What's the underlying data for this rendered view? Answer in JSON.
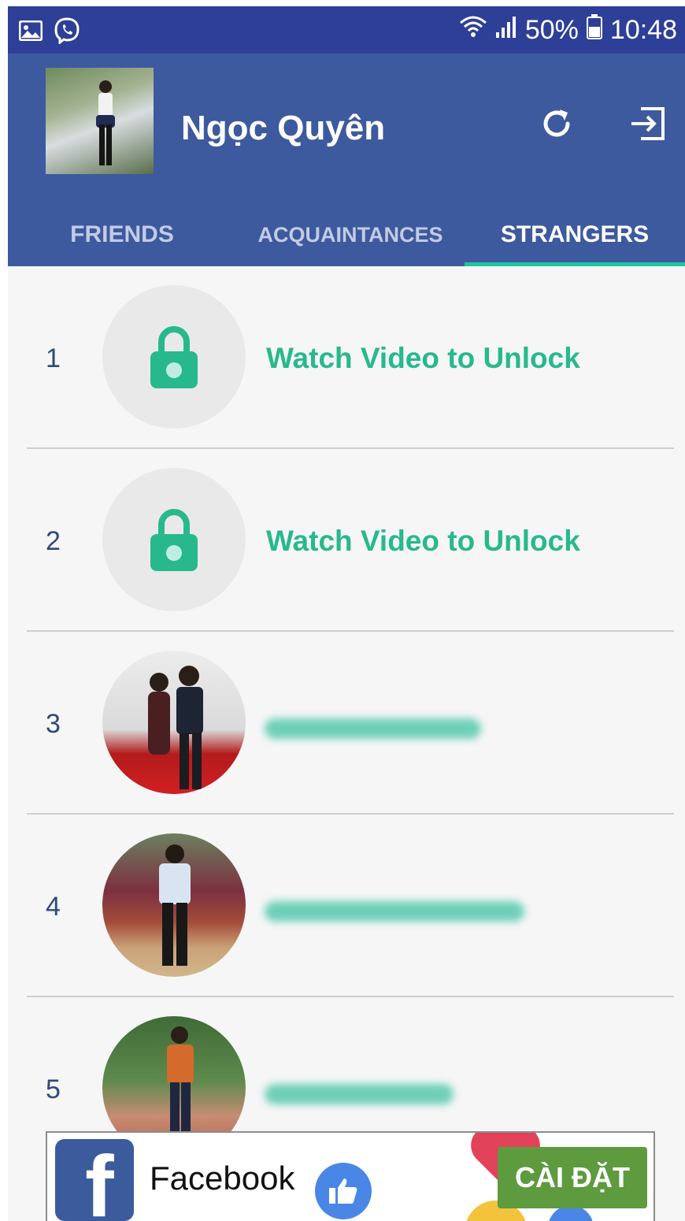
{
  "status_bar": {
    "signal_percent": "50%",
    "time": "10:48",
    "icons": [
      "gallery-icon",
      "viber-icon",
      "wifi-icon",
      "signal-icon",
      "battery-icon"
    ]
  },
  "header": {
    "profile_name": "Ngọc Quyên",
    "actions": [
      "refresh-icon",
      "logout-icon"
    ],
    "colors": {
      "status_bar": "#2d3f96",
      "header": "#3d5a9e",
      "accent": "#1fc4a0"
    }
  },
  "tabs": [
    {
      "label": "FRIENDS",
      "selected": false
    },
    {
      "label": "ACQUAINTANCES",
      "selected": false
    },
    {
      "label": "STRANGERS",
      "selected": true
    }
  ],
  "list": {
    "items": [
      {
        "rank": "1",
        "locked": true,
        "label": "Watch Video to Unlock"
      },
      {
        "rank": "2",
        "locked": true,
        "label": "Watch Video to Unlock"
      },
      {
        "rank": "3",
        "locked": false,
        "label": ""
      },
      {
        "rank": "4",
        "locked": false,
        "label": ""
      },
      {
        "rank": "5",
        "locked": false,
        "label": ""
      }
    ]
  },
  "ad": {
    "title": "Facebook",
    "install_label": "CÀI ĐẶT"
  }
}
